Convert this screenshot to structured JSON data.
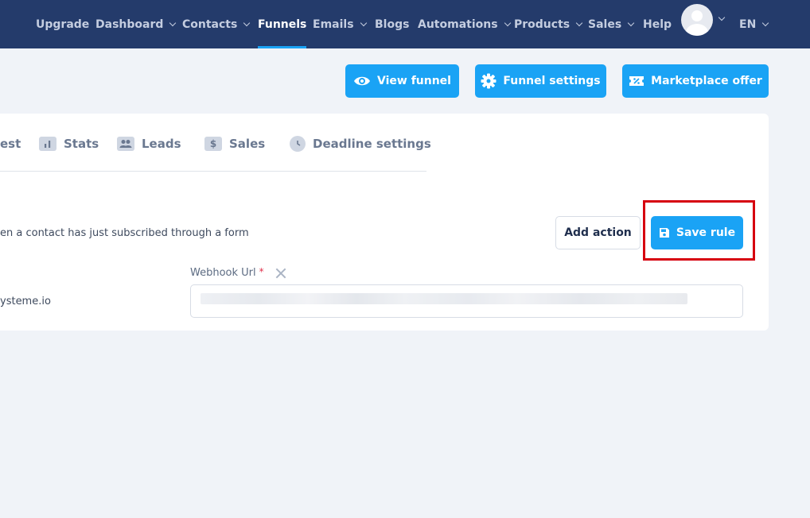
{
  "nav": {
    "items": [
      {
        "label": "Upgrade",
        "dropdown": false,
        "active": false
      },
      {
        "label": "Dashboard",
        "dropdown": true,
        "active": false
      },
      {
        "label": "Contacts",
        "dropdown": true,
        "active": false
      },
      {
        "label": "Funnels",
        "dropdown": false,
        "active": true
      },
      {
        "label": "Emails",
        "dropdown": true,
        "active": false
      },
      {
        "label": "Blogs",
        "dropdown": false,
        "active": false
      },
      {
        "label": "Automations",
        "dropdown": true,
        "active": false
      },
      {
        "label": "Products",
        "dropdown": true,
        "active": false
      },
      {
        "label": "Sales",
        "dropdown": true,
        "active": false
      },
      {
        "label": "Help",
        "dropdown": false,
        "active": false
      }
    ],
    "language": "EN"
  },
  "actions": {
    "view_funnel": "View funnel",
    "funnel_settings": "Funnel settings",
    "marketplace_offer": "Marketplace offer"
  },
  "tabs": {
    "partial": "est",
    "stats": "Stats",
    "leads": "Leads",
    "sales": "Sales",
    "deadline": "Deadline settings"
  },
  "rule": {
    "trigger_text": "en a contact has just subscribed through a form",
    "add_action": "Add action",
    "save_rule": "Save rule",
    "webhook_label": "Webhook Url",
    "required_mark": "*",
    "side_text": "ysteme.io",
    "webhook_value_visible": false
  },
  "colors": {
    "nav_bg": "#243b6b",
    "accent": "#1aa3f5",
    "highlight": "#d6000f",
    "page_bg": "#f0f3f8"
  }
}
